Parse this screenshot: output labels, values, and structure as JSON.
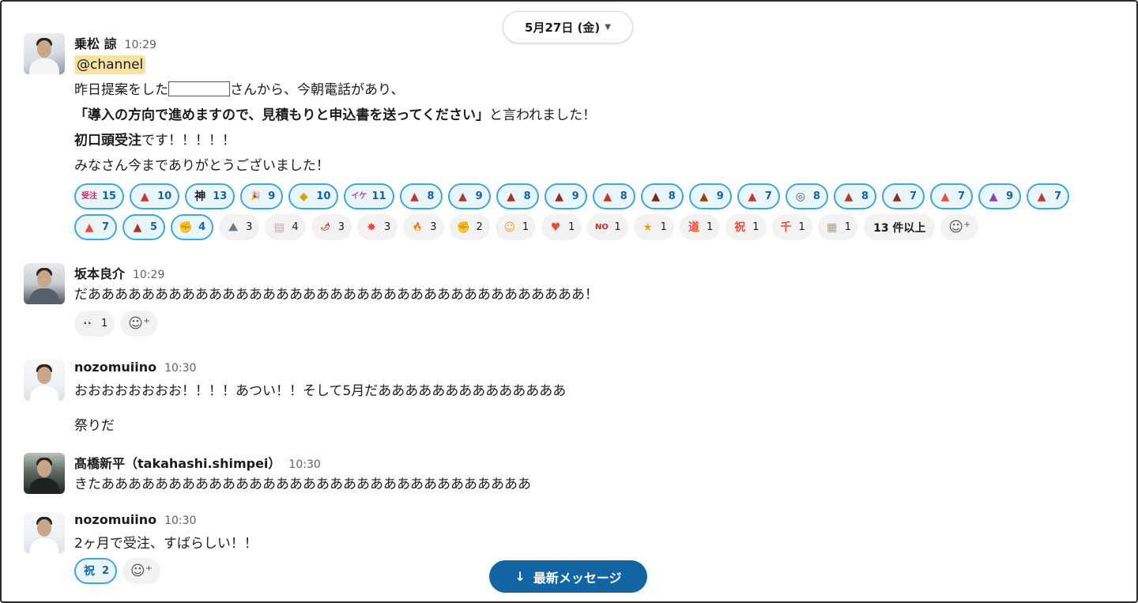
{
  "date_divider": {
    "label": "5月27日 (金)",
    "chevron": "chevron-down-icon"
  },
  "messages": [
    {
      "author": "乗松 諒",
      "time": "10:29",
      "mention": "@channel",
      "line1_before": "昨日提案をした",
      "line1_after": "さんから、今朝電話があり、",
      "line2_bold": "「導入の方向で進めますので、見積もりと申込書を送ってください」",
      "line2_rest": "と言われました！",
      "line3_bold": "初口頭受注",
      "line3_rest": "です！！！！！",
      "line4": "みなさん今までありがとうございました！",
      "reactions": [
        {
          "icon": "jyuchu-text-emoji",
          "glyph": "受注",
          "count": "15",
          "active": true,
          "color": "#e01e5a"
        },
        {
          "icon": "volcano-emoji",
          "glyph": "▲",
          "count": "10",
          "active": true,
          "color": "#c0392b"
        },
        {
          "icon": "kami-text-emoji",
          "glyph": "神",
          "count": "13",
          "active": true,
          "color": "#1d1c1d"
        },
        {
          "icon": "party-popper-emoji",
          "glyph": "🎉",
          "count": "9",
          "active": true,
          "color": "#e8a317"
        },
        {
          "icon": "super-saiyan-emoji",
          "glyph": "◆",
          "count": "10",
          "active": true,
          "color": "#d4a017"
        },
        {
          "icon": "ikemen-text-emoji",
          "glyph": "イケ",
          "count": "11",
          "active": true,
          "color": "#c038b8"
        },
        {
          "icon": "volcano-emoji",
          "glyph": "▲",
          "count": "8",
          "active": true,
          "color": "#c0392b"
        },
        {
          "icon": "volcano-emoji",
          "glyph": "▲",
          "count": "9",
          "active": true,
          "color": "#b03a2e"
        },
        {
          "icon": "volcano-emoji",
          "glyph": "▲",
          "count": "8",
          "active": true,
          "color": "#a93226"
        },
        {
          "icon": "volcano-emoji",
          "glyph": "▲",
          "count": "9",
          "active": true,
          "color": "#922b21"
        },
        {
          "icon": "volcano-emoji",
          "glyph": "▲",
          "count": "8",
          "active": true,
          "color": "#c0392b"
        },
        {
          "icon": "volcano-emoji",
          "glyph": "▲",
          "count": "8",
          "active": true,
          "color": "#7b241c"
        },
        {
          "icon": "volcano-emoji",
          "glyph": "▲",
          "count": "9",
          "active": true,
          "color": "#a04000"
        },
        {
          "icon": "volcano-emoji",
          "glyph": "▲",
          "count": "7",
          "active": true,
          "color": "#c0392b"
        },
        {
          "icon": "spiral-emoji",
          "glyph": "◎",
          "count": "8",
          "active": true,
          "color": "#555555"
        },
        {
          "icon": "volcano-emoji",
          "glyph": "▲",
          "count": "8",
          "active": true,
          "color": "#b03a2e"
        },
        {
          "icon": "volcano-emoji",
          "glyph": "▲",
          "count": "7",
          "active": true,
          "color": "#922b21"
        },
        {
          "icon": "volcano-emoji",
          "glyph": "▲",
          "count": "7",
          "active": true,
          "color": "#e74c3c"
        },
        {
          "icon": "volcano-emoji",
          "glyph": "▲",
          "count": "9",
          "active": true,
          "color": "#8e44ad"
        },
        {
          "icon": "volcano-emoji",
          "glyph": "▲",
          "count": "7",
          "active": true,
          "color": "#c0392b"
        },
        {
          "icon": "volcano-emoji",
          "glyph": "▲",
          "count": "7",
          "active": true,
          "color": "#e74c3c"
        },
        {
          "icon": "volcano-emoji",
          "glyph": "▲",
          "count": "5",
          "active": true,
          "color": "#a93226"
        },
        {
          "icon": "fist-bump-emoji",
          "glyph": "✊",
          "count": "4",
          "active": true,
          "color": "#f0b429"
        },
        {
          "icon": "hiker-emoji",
          "glyph": "⛰",
          "count": "3",
          "active": false,
          "color": "#6c7a89"
        },
        {
          "icon": "pink-text-emoji",
          "glyph": "▤",
          "count": "4",
          "active": false,
          "color": "#f1948a"
        },
        {
          "icon": "chili-pepper-emoji",
          "glyph": "🌶",
          "count": "3",
          "active": false,
          "color": "#c0392b"
        },
        {
          "icon": "explosion-emoji",
          "glyph": "✸",
          "count": "3",
          "active": false,
          "color": "#e74c3c"
        },
        {
          "icon": "fire-emoji",
          "glyph": "🔥",
          "count": "3",
          "active": false,
          "color": "#e67e22"
        },
        {
          "icon": "muscle-emoji",
          "glyph": "✊",
          "count": "2",
          "active": false,
          "color": "#a0522d"
        },
        {
          "icon": "relieved-face-emoji",
          "glyph": "☺",
          "count": "1",
          "active": false,
          "color": "#e8a317"
        },
        {
          "icon": "smiling-face-hearts-emoji",
          "glyph": "♥",
          "count": "1",
          "active": false,
          "color": "#e74c3c"
        },
        {
          "icon": "no-text-emoji",
          "glyph": "NO",
          "count": "1",
          "active": false,
          "color": "#e01e1e"
        },
        {
          "icon": "star-struck-emoji",
          "glyph": "★",
          "count": "1",
          "active": false,
          "color": "#e8a317"
        },
        {
          "icon": "red-kanji-emoji",
          "glyph": "道",
          "count": "1",
          "active": false,
          "color": "#e74c3c"
        },
        {
          "icon": "red-kanji-emoji",
          "glyph": "祝",
          "count": "1",
          "active": false,
          "color": "#e74c3c"
        },
        {
          "icon": "red-kanji-emoji",
          "glyph": "千",
          "count": "1",
          "active": false,
          "color": "#e74c3c"
        },
        {
          "icon": "pink-text-emoji",
          "glyph": "▦",
          "count": "1",
          "active": false,
          "color": "#d98880"
        }
      ],
      "more_label": "13 件以上",
      "add_reaction_icon": "add-reaction-icon"
    },
    {
      "author": "坂本良介",
      "time": "10:29",
      "text": "だあああああああああああああああああああああああああああああああああああああ！",
      "reactions": [
        {
          "icon": "eyes-emoji",
          "glyph": "👀",
          "count": "1",
          "active": false,
          "color": "#1d1c1d"
        }
      ]
    },
    {
      "author": "nozomuiino",
      "time": "10:30",
      "text": "おおおおおおおお！！！！あつい！！そして5月だああああああああああああああ",
      "text2": "祭りだ"
    },
    {
      "author": "髙橋新平（takahashi.shimpei）",
      "time": "10:30",
      "text": "きたああああああああああああああああああああああああああああああああ"
    },
    {
      "author": "nozomuiino",
      "time": "10:30",
      "text": "2ヶ月で受注、すばらしい！！",
      "reactions": [
        {
          "icon": "shinsotsu-text-emoji",
          "glyph": "祝",
          "count": "2",
          "active": true,
          "color": "#1264a3"
        }
      ]
    }
  ],
  "jump_button": {
    "label": "最新メッセージ",
    "icon": "arrow-down-icon"
  }
}
